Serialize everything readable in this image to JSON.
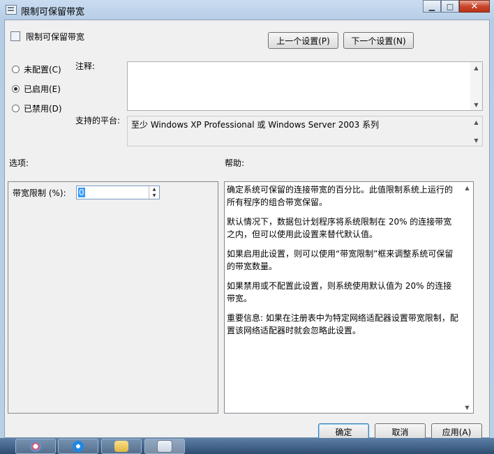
{
  "window": {
    "title": "限制可保留带宽",
    "min_glyph": "▁",
    "max_glyph": "□",
    "close_glyph": "✕"
  },
  "header": {
    "policy_name": "限制可保留带宽",
    "prev_label": "上一个设置(P)",
    "next_label": "下一个设置(N)"
  },
  "state": {
    "options": [
      {
        "label": "未配置(C)",
        "checked": false
      },
      {
        "label": "已启用(E)",
        "checked": true
      },
      {
        "label": "已禁用(D)",
        "checked": false
      }
    ]
  },
  "comment": {
    "label": "注释:",
    "value": ""
  },
  "platform": {
    "label": "支持的平台:",
    "value": "至少 Windows XP Professional 或 Windows Server 2003 系列"
  },
  "options_section": {
    "label": "选项:",
    "bandwidth_label": "带宽限制 (%):",
    "bandwidth_value": "0"
  },
  "help_section": {
    "label": "帮助:",
    "paragraphs": [
      "确定系统可保留的连接带宽的百分比。此值限制系统上运行的所有程序的组合带宽保留。",
      "默认情况下，数据包计划程序将系统限制在 20% 的连接带宽之内，但可以使用此设置来替代默认值。",
      "如果启用此设置，则可以使用“带宽限制”框来调整系统可保留的带宽数量。",
      "如果禁用或不配置此设置，则系统使用默认值为 20% 的连接带宽。",
      "重要信息: 如果在注册表中为特定网络适配器设置带宽限制，配置该网络适配器时就会忽略此设置。"
    ]
  },
  "footer": {
    "ok_label": "确定",
    "cancel_label": "取消",
    "apply_label": "应用(A)"
  },
  "scroll_glyphs": {
    "up": "▲",
    "down": "▼"
  },
  "colors": {
    "accent": "#3399ff",
    "titlebar": "#c9dcf0",
    "close": "#c9462c"
  }
}
